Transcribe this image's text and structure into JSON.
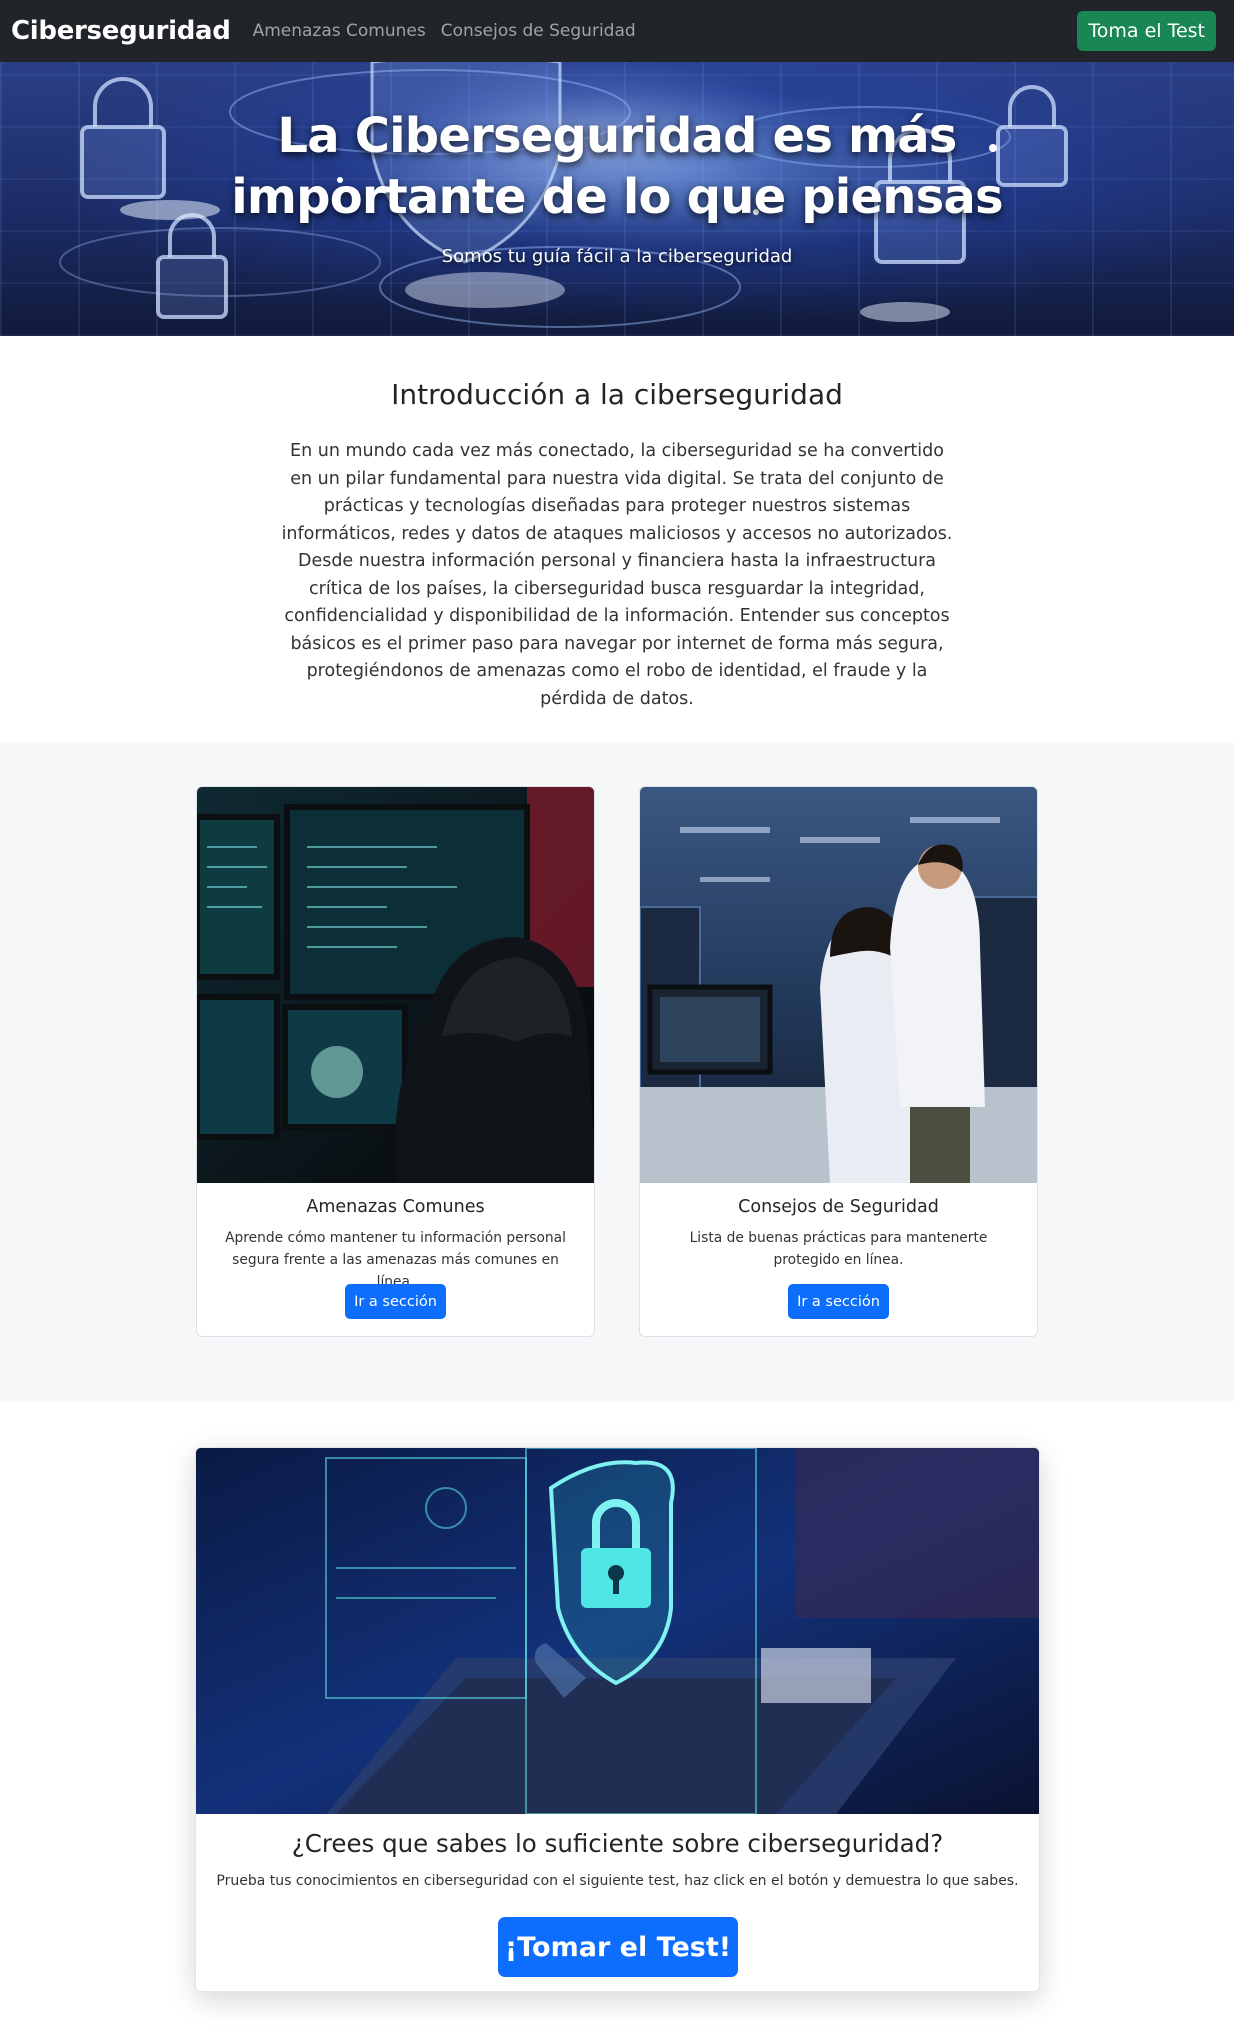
{
  "nav": {
    "brand": "Ciberseguridad",
    "links": [
      "Amenazas Comunes",
      "Consejos de Seguridad"
    ],
    "cta_label": "Toma el Test"
  },
  "hero": {
    "title_line1": "La Ciberseguridad es más",
    "title_line2": "importante de lo que piensas",
    "subtitle": "Somos tu guía fácil a la ciberseguridad"
  },
  "intro": {
    "title": "Introducción a la ciberseguridad",
    "text": "En un mundo cada vez más conectado, la ciberseguridad se ha convertido en un pilar fundamental para nuestra vida digital. Se trata del conjunto de prácticas y tecnologías diseñadas para proteger nuestros sistemas informáticos, redes y datos de ataques maliciosos y accesos no autorizados. Desde nuestra información personal y financiera hasta la infraestructura crítica de los países, la ciberseguridad busca resguardar la integridad, confidencialidad y disponibilidad de la información. Entender sus conceptos básicos es el primer paso para navegar por internet de forma más segura, protegiéndonos de amenazas como el robo de identidad, el fraude y la pérdida de datos."
  },
  "cards": [
    {
      "title": "Amenazas Comunes",
      "text": "Aprende cómo mantener tu información personal segura frente a las amenazas más comunes en línea.",
      "button": "Ir a sección"
    },
    {
      "title": "Consejos de Seguridad",
      "text": "Lista de buenas prácticas para mantenerte protegido en línea.",
      "button": "Ir a sección"
    }
  ],
  "cta": {
    "title": "¿Crees que sabes lo suficiente sobre ciberseguridad?",
    "text": "Prueba tus conocimientos en ciberseguridad con el siguiente test, haz click en el botón y demuestra lo que sabes.",
    "button": "¡Tomar el Test!"
  },
  "colors": {
    "navbar_bg": "#212529",
    "success": "#198754",
    "primary": "#0d6efd",
    "section_bg": "#f5f7f9"
  },
  "icons": {
    "hero_image": "padlock-network-illustration",
    "card1_image": "hooded-hacker-photo",
    "card2_image": "data-center-team-photo",
    "cta_image": "shield-padlock-laptop-illustration"
  }
}
